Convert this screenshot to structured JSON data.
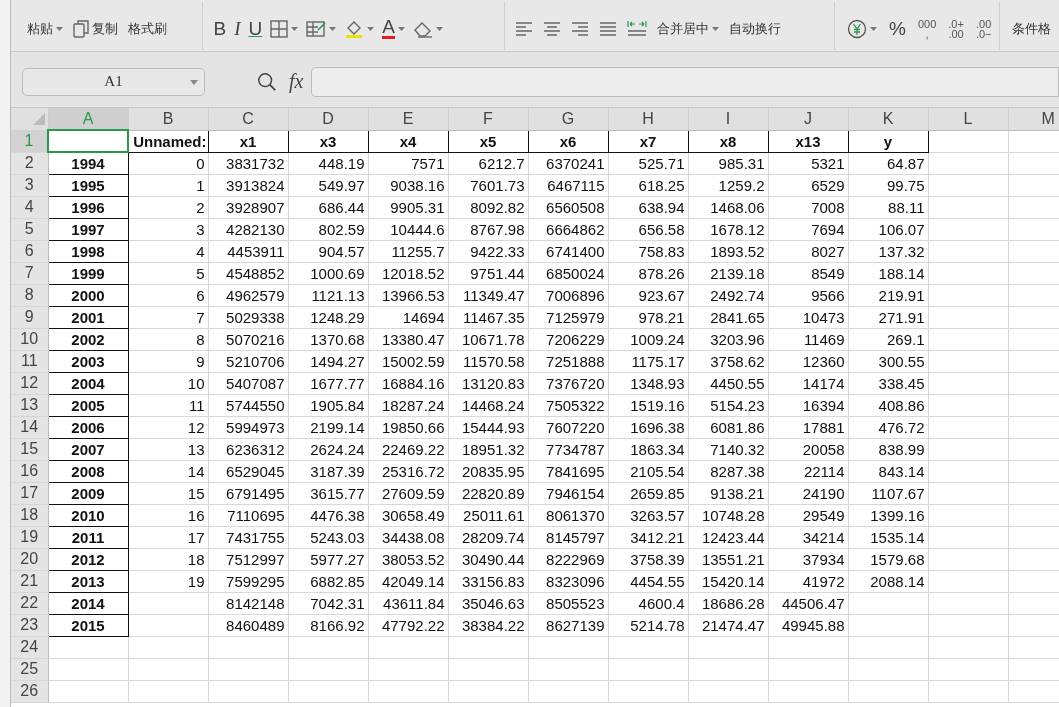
{
  "toolbar": {
    "groups": [
      {
        "items": [
          {
            "kind": "label",
            "label": "粘贴",
            "dropdown": true
          },
          {
            "kind": "copy",
            "label": "复制"
          },
          {
            "kind": "label",
            "label": "格式刷"
          }
        ]
      },
      {
        "items": [
          {
            "kind": "bold",
            "text": "B"
          },
          {
            "kind": "italic",
            "text": "I"
          },
          {
            "kind": "underline",
            "text": "U"
          },
          {
            "kind": "borders",
            "dropdown": true
          },
          {
            "kind": "tablestyle",
            "dropdown": true
          },
          {
            "kind": "fill",
            "dropdown": true
          },
          {
            "kind": "fontcolor",
            "text": "A",
            "dropdown": true
          },
          {
            "kind": "eraser",
            "dropdown": true
          }
        ]
      },
      {
        "items": [
          {
            "kind": "alignleft"
          },
          {
            "kind": "aligncenter"
          },
          {
            "kind": "alignright"
          },
          {
            "kind": "justify"
          },
          {
            "kind": "distribute"
          },
          {
            "kind": "label",
            "label": "合并居中",
            "dropdown": true
          },
          {
            "kind": "label",
            "label": "自动换行"
          }
        ]
      },
      {
        "items": [
          {
            "kind": "currency",
            "dropdown": true
          },
          {
            "kind": "plain",
            "text": "%"
          },
          {
            "kind": "stack",
            "lines": [
              "000",
              ","
            ]
          },
          {
            "kind": "stack",
            "lines": [
              ".0+",
              ".00"
            ]
          },
          {
            "kind": "stack",
            "lines": [
              ".00",
              ".0−"
            ]
          }
        ]
      },
      {
        "items": [
          {
            "kind": "label",
            "label": "条件格"
          }
        ]
      }
    ]
  },
  "formula_bar": {
    "name_box": "A1",
    "function_label": "fx"
  },
  "sheet": {
    "columns": [
      {
        "label": "A",
        "selected": true
      },
      {
        "label": "B",
        "selected": false
      },
      {
        "label": "C",
        "selected": false
      },
      {
        "label": "D",
        "selected": false
      },
      {
        "label": "E",
        "selected": false
      },
      {
        "label": "F",
        "selected": false
      },
      {
        "label": "G",
        "selected": false
      },
      {
        "label": "H",
        "selected": false
      },
      {
        "label": "I",
        "selected": false
      },
      {
        "label": "J",
        "selected": false
      },
      {
        "label": "K",
        "selected": false
      },
      {
        "label": "L",
        "selected": false
      },
      {
        "label": "M",
        "selected": false
      }
    ],
    "rows": [
      {
        "number": "1",
        "selected": true,
        "kind": "header",
        "cells": [
          null,
          "Unnamed:",
          "x1",
          "x3",
          "x4",
          "x5",
          "x6",
          "x7",
          "x8",
          "x13",
          "y"
        ]
      },
      {
        "number": "2",
        "selected": false,
        "kind": "data",
        "cells": [
          "1994",
          "0",
          "3831732",
          "448.19",
          "7571",
          "6212.7",
          "6370241",
          "525.71",
          "985.31",
          "5321",
          "64.87"
        ]
      },
      {
        "number": "3",
        "selected": false,
        "kind": "data",
        "cells": [
          "1995",
          "1",
          "3913824",
          "549.97",
          "9038.16",
          "7601.73",
          "6467115",
          "618.25",
          "1259.2",
          "6529",
          "99.75"
        ]
      },
      {
        "number": "4",
        "selected": false,
        "kind": "data",
        "cells": [
          "1996",
          "2",
          "3928907",
          "686.44",
          "9905.31",
          "8092.82",
          "6560508",
          "638.94",
          "1468.06",
          "7008",
          "88.11"
        ]
      },
      {
        "number": "5",
        "selected": false,
        "kind": "data",
        "cells": [
          "1997",
          "3",
          "4282130",
          "802.59",
          "10444.6",
          "8767.98",
          "6664862",
          "656.58",
          "1678.12",
          "7694",
          "106.07"
        ]
      },
      {
        "number": "6",
        "selected": false,
        "kind": "data",
        "cells": [
          "1998",
          "4",
          "4453911",
          "904.57",
          "11255.7",
          "9422.33",
          "6741400",
          "758.83",
          "1893.52",
          "8027",
          "137.32"
        ]
      },
      {
        "number": "7",
        "selected": false,
        "kind": "data",
        "cells": [
          "1999",
          "5",
          "4548852",
          "1000.69",
          "12018.52",
          "9751.44",
          "6850024",
          "878.26",
          "2139.18",
          "8549",
          "188.14"
        ]
      },
      {
        "number": "8",
        "selected": false,
        "kind": "data",
        "cells": [
          "2000",
          "6",
          "4962579",
          "1121.13",
          "13966.53",
          "11349.47",
          "7006896",
          "923.67",
          "2492.74",
          "9566",
          "219.91"
        ]
      },
      {
        "number": "9",
        "selected": false,
        "kind": "data",
        "cells": [
          "2001",
          "7",
          "5029338",
          "1248.29",
          "14694",
          "11467.35",
          "7125979",
          "978.21",
          "2841.65",
          "10473",
          "271.91"
        ]
      },
      {
        "number": "10",
        "selected": false,
        "kind": "data",
        "cells": [
          "2002",
          "8",
          "5070216",
          "1370.68",
          "13380.47",
          "10671.78",
          "7206229",
          "1009.24",
          "3203.96",
          "11469",
          "269.1"
        ]
      },
      {
        "number": "11",
        "selected": false,
        "kind": "data",
        "cells": [
          "2003",
          "9",
          "5210706",
          "1494.27",
          "15002.59",
          "11570.58",
          "7251888",
          "1175.17",
          "3758.62",
          "12360",
          "300.55"
        ]
      },
      {
        "number": "12",
        "selected": false,
        "kind": "data",
        "cells": [
          "2004",
          "10",
          "5407087",
          "1677.77",
          "16884.16",
          "13120.83",
          "7376720",
          "1348.93",
          "4450.55",
          "14174",
          "338.45"
        ]
      },
      {
        "number": "13",
        "selected": false,
        "kind": "data",
        "cells": [
          "2005",
          "11",
          "5744550",
          "1905.84",
          "18287.24",
          "14468.24",
          "7505322",
          "1519.16",
          "5154.23",
          "16394",
          "408.86"
        ]
      },
      {
        "number": "14",
        "selected": false,
        "kind": "data",
        "cells": [
          "2006",
          "12",
          "5994973",
          "2199.14",
          "19850.66",
          "15444.93",
          "7607220",
          "1696.38",
          "6081.86",
          "17881",
          "476.72"
        ]
      },
      {
        "number": "15",
        "selected": false,
        "kind": "data",
        "cells": [
          "2007",
          "13",
          "6236312",
          "2624.24",
          "22469.22",
          "18951.32",
          "7734787",
          "1863.34",
          "7140.32",
          "20058",
          "838.99"
        ]
      },
      {
        "number": "16",
        "selected": false,
        "kind": "data",
        "cells": [
          "2008",
          "14",
          "6529045",
          "3187.39",
          "25316.72",
          "20835.95",
          "7841695",
          "2105.54",
          "8287.38",
          "22114",
          "843.14"
        ]
      },
      {
        "number": "17",
        "selected": false,
        "kind": "data",
        "cells": [
          "2009",
          "15",
          "6791495",
          "3615.77",
          "27609.59",
          "22820.89",
          "7946154",
          "2659.85",
          "9138.21",
          "24190",
          "1107.67"
        ]
      },
      {
        "number": "18",
        "selected": false,
        "kind": "data",
        "cells": [
          "2010",
          "16",
          "7110695",
          "4476.38",
          "30658.49",
          "25011.61",
          "8061370",
          "3263.57",
          "10748.28",
          "29549",
          "1399.16"
        ]
      },
      {
        "number": "19",
        "selected": false,
        "kind": "data",
        "cells": [
          "2011",
          "17",
          "7431755",
          "5243.03",
          "34438.08",
          "28209.74",
          "8145797",
          "3412.21",
          "12423.44",
          "34214",
          "1535.14"
        ]
      },
      {
        "number": "20",
        "selected": false,
        "kind": "data",
        "cells": [
          "2012",
          "18",
          "7512997",
          "5977.27",
          "38053.52",
          "30490.44",
          "8222969",
          "3758.39",
          "13551.21",
          "37934",
          "1579.68"
        ]
      },
      {
        "number": "21",
        "selected": false,
        "kind": "data",
        "cells": [
          "2013",
          "19",
          "7599295",
          "6882.85",
          "42049.14",
          "33156.83",
          "8323096",
          "4454.55",
          "15420.14",
          "41972",
          "2088.14"
        ]
      },
      {
        "number": "22",
        "selected": false,
        "kind": "data",
        "cells": [
          "2014",
          null,
          "8142148",
          "7042.31",
          "43611.84",
          "35046.63",
          "8505523",
          "4600.4",
          "18686.28",
          "44506.47"
        ]
      },
      {
        "number": "23",
        "selected": false,
        "kind": "data",
        "cells": [
          "2015",
          null,
          "8460489",
          "8166.92",
          "47792.22",
          "38384.22",
          "8627139",
          "5214.78",
          "21474.47",
          "49945.88"
        ]
      },
      {
        "number": "24",
        "selected": false,
        "kind": "empty"
      },
      {
        "number": "25",
        "selected": false,
        "kind": "empty"
      },
      {
        "number": "26",
        "selected": false,
        "kind": "empty"
      }
    ]
  }
}
